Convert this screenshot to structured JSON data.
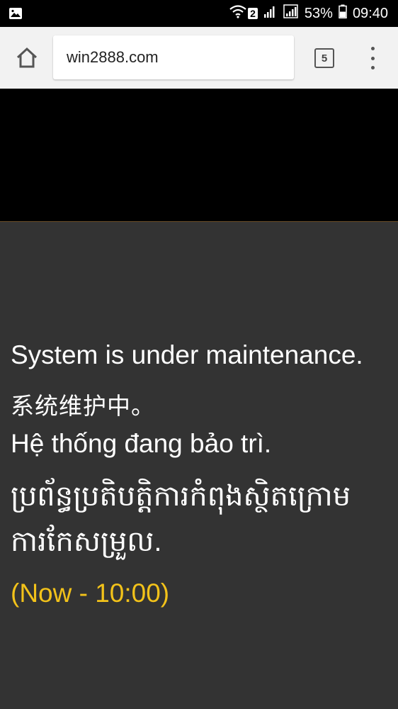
{
  "status_bar": {
    "notification_icon": "image-icon",
    "wifi_badge": "2",
    "battery_percent": "53%",
    "time": "09:40"
  },
  "browser": {
    "url": "win2888.com",
    "tab_count": "5"
  },
  "maintenance": {
    "english": "System is under maintenance.",
    "chinese": "系统维护中。",
    "vietnamese": "Hệ thống đang bảo trì.",
    "khmer": "ប្រព័ន្ធប្រតិបត្តិការកំពុងស្ថិតក្រោមការកែសម្រួល.",
    "time_range": "(Now - 10:00)"
  },
  "colors": {
    "background": "#333333",
    "highlight": "#f2c21a"
  }
}
